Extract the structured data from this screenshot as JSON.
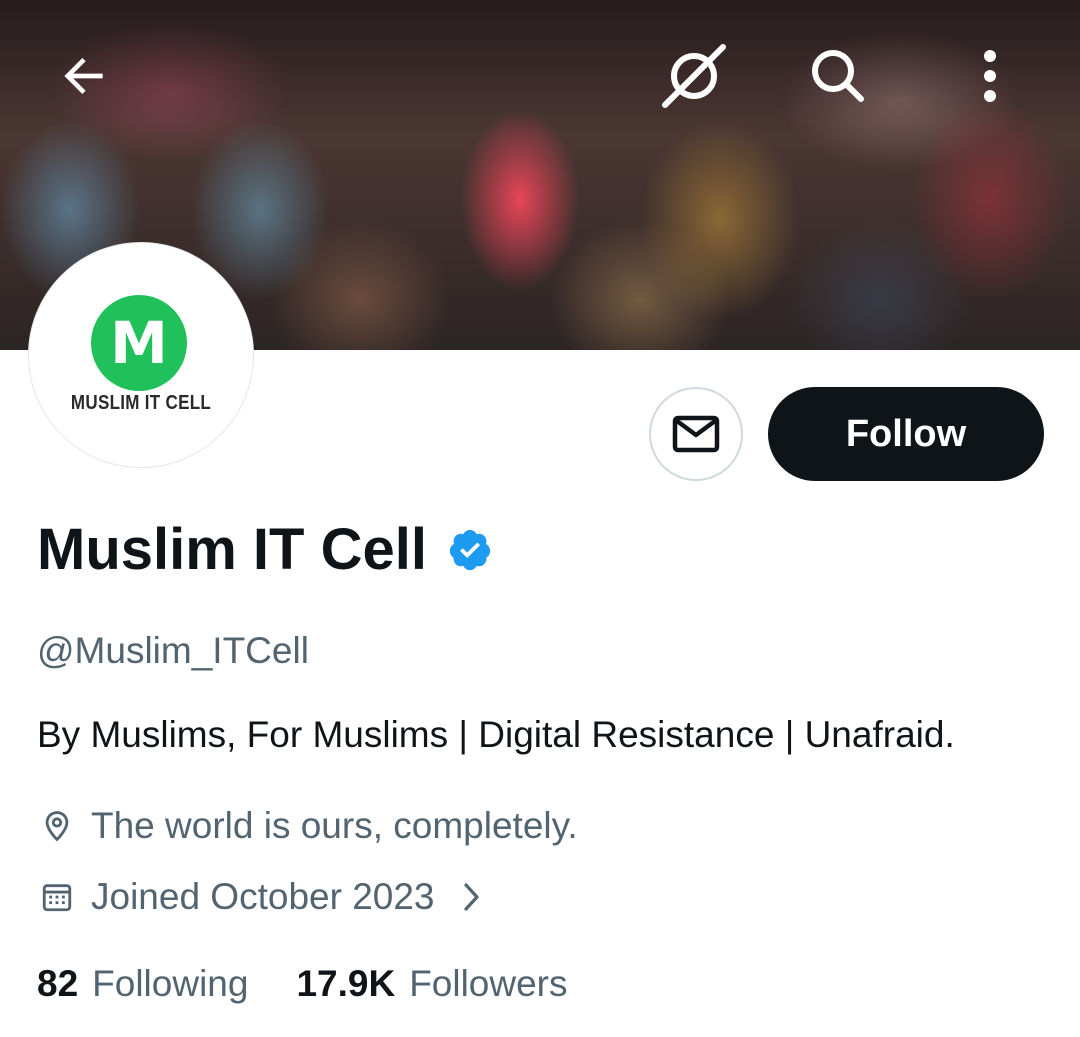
{
  "header": {
    "back_icon": "arrow-left-icon",
    "grok_icon": "grok-icon",
    "search_icon": "search-icon",
    "more_icon": "more-vertical-icon"
  },
  "avatar": {
    "letter": "M",
    "caption": "MUSLIM IT CELL",
    "color": "#20c05b"
  },
  "actions": {
    "message_icon": "envelope-icon",
    "follow_label": "Follow"
  },
  "profile": {
    "display_name": "Muslim IT Cell",
    "verified_color": "#1d9bf0",
    "handle": "@Muslim_ITCell",
    "bio": "By Muslims, For Muslims | Digital Resistance | Unafraid.",
    "location": "The world is ours, completely.",
    "joined": "Joined October 2023"
  },
  "stats": {
    "following_count": "82",
    "following_label": "Following",
    "followers_count": "17.9K",
    "followers_label": "Followers"
  }
}
